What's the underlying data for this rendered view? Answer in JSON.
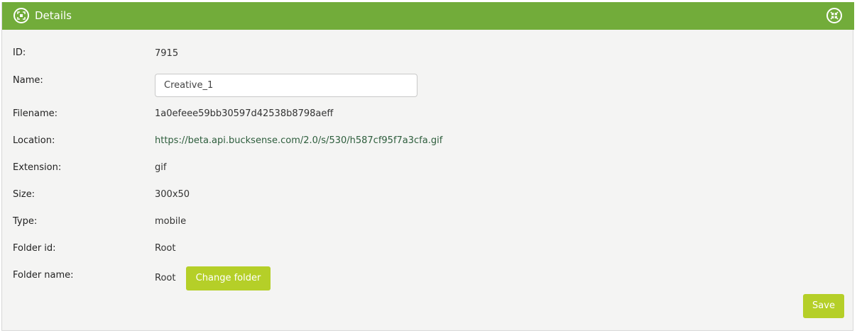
{
  "header": {
    "title": "Details",
    "left_icon": "focus-frame-icon",
    "right_icon": "collapse-icon",
    "color": "#72ac3a"
  },
  "fields": {
    "id": {
      "label": "ID:",
      "value": "7915"
    },
    "name": {
      "label": "Name:",
      "value": "Creative_1"
    },
    "filename": {
      "label": "Filename:",
      "value": "1a0efeee59bb30597d42538b8798aeff"
    },
    "location": {
      "label": "Location:",
      "value": "https://beta.api.bucksense.com/2.0/s/530/h587cf95f7a3cfa.gif"
    },
    "extension": {
      "label": "Extension:",
      "value": "gif"
    },
    "size": {
      "label": "Size:",
      "value": "300x50"
    },
    "type": {
      "label": "Type:",
      "value": "mobile"
    },
    "folder_id": {
      "label": "Folder id:",
      "value": "Root"
    },
    "folder_name": {
      "label": "Folder name:",
      "value": "Root"
    }
  },
  "buttons": {
    "change_folder": "Change folder",
    "save": "Save",
    "color": "#b5cf28"
  }
}
